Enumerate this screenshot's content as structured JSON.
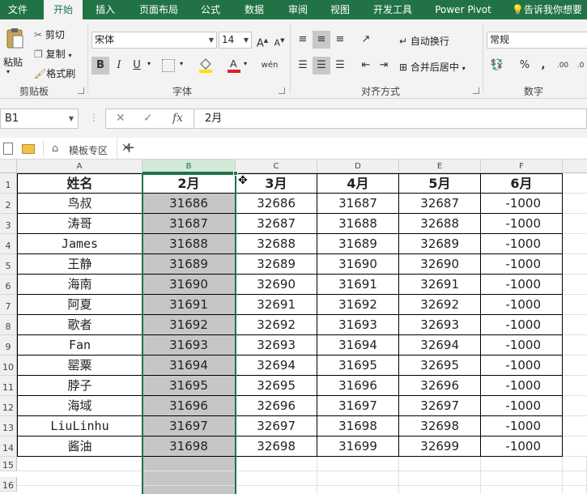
{
  "ribbon_tabs": [
    "文件",
    "开始",
    "插入",
    "页面布局",
    "公式",
    "数据",
    "审阅",
    "视图",
    "开发工具",
    "Power Pivot"
  ],
  "active_tab": "开始",
  "tell_me": "告诉我你想要",
  "clipboard": {
    "paste": "粘贴",
    "cut": "剪切",
    "copy": "复制",
    "format_painter": "格式刷",
    "group_label": "剪贴板"
  },
  "font": {
    "name": "宋体",
    "size": "14",
    "bold": "B",
    "italic": "I",
    "underline": "U",
    "group_label": "字体",
    "font_color": "#e02020",
    "fill_color": "#ffe100"
  },
  "alignment": {
    "wrap_text": "自动换行",
    "merge_center": "合并后居中",
    "group_label": "对齐方式"
  },
  "number": {
    "format": "常规",
    "percent": "%",
    "comma": ",",
    "group_label": "数字"
  },
  "formula_bar": {
    "name_box": "B1",
    "fx": "fx",
    "value": "2月"
  },
  "doc_tabs": {
    "template_tab": "模板专区",
    "add": "+"
  },
  "sheet": {
    "columns": [
      "A",
      "B",
      "C",
      "D",
      "E",
      "F"
    ],
    "selected_column": "B",
    "row_numbers": [
      "1",
      "2",
      "3",
      "4",
      "5",
      "6",
      "7",
      "8",
      "9",
      "10",
      "11",
      "12",
      "13",
      "14",
      "15",
      "16"
    ],
    "header_row": [
      "姓名",
      "2月",
      "3月",
      "4月",
      "5月",
      "6月"
    ],
    "rows": [
      [
        "鸟叔",
        "31686",
        "32686",
        "31687",
        "32687",
        "-1000"
      ],
      [
        "涛哥",
        "31687",
        "32687",
        "31688",
        "32688",
        "-1000"
      ],
      [
        "James",
        "31688",
        "32688",
        "31689",
        "32689",
        "-1000"
      ],
      [
        "王静",
        "31689",
        "32689",
        "31690",
        "32690",
        "-1000"
      ],
      [
        "海南",
        "31690",
        "32690",
        "31691",
        "32691",
        "-1000"
      ],
      [
        "阿夏",
        "31691",
        "32691",
        "31692",
        "32692",
        "-1000"
      ],
      [
        "歌者",
        "31692",
        "32692",
        "31693",
        "32693",
        "-1000"
      ],
      [
        "Fan",
        "31693",
        "32693",
        "31694",
        "32694",
        "-1000"
      ],
      [
        "罂粟",
        "31694",
        "32694",
        "31695",
        "32695",
        "-1000"
      ],
      [
        "脖子",
        "31695",
        "32695",
        "31696",
        "32696",
        "-1000"
      ],
      [
        "海域",
        "31696",
        "32696",
        "31697",
        "32697",
        "-1000"
      ],
      [
        "LiuLinhu",
        "31697",
        "32697",
        "31698",
        "32698",
        "-1000"
      ],
      [
        "酱油",
        "31698",
        "32698",
        "31699",
        "32699",
        "-1000"
      ]
    ]
  },
  "colors": {
    "accent": "#217346",
    "selection_fill": "#c6c6c6"
  }
}
